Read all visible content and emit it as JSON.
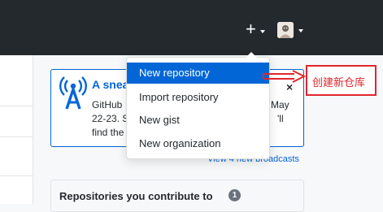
{
  "header": {
    "new_menu_icon": "plus-icon",
    "avatar_icon": "avatar-icon"
  },
  "broadcast": {
    "title": "A snea",
    "line1_left": "GitHub",
    "line1_right": "May",
    "line2_left": "22-23. S",
    "line2_right": "'ll",
    "line3_left": "find the",
    "close_label": "×"
  },
  "broadcasts_link": "View 4 new broadcasts",
  "repositories": {
    "title": "Repositories you contribute to",
    "count": "1"
  },
  "dropdown": {
    "items": [
      {
        "label": "New repository",
        "active": true
      },
      {
        "label": "Import repository",
        "active": false
      },
      {
        "label": "New gist",
        "active": false
      },
      {
        "label": "New organization",
        "active": false
      }
    ]
  },
  "annotation": {
    "text": "创建新仓库",
    "color": "#e0262c"
  },
  "colors": {
    "header_bg": "#24292e",
    "accent": "#0366d6",
    "annotation_red": "#e0262c"
  }
}
